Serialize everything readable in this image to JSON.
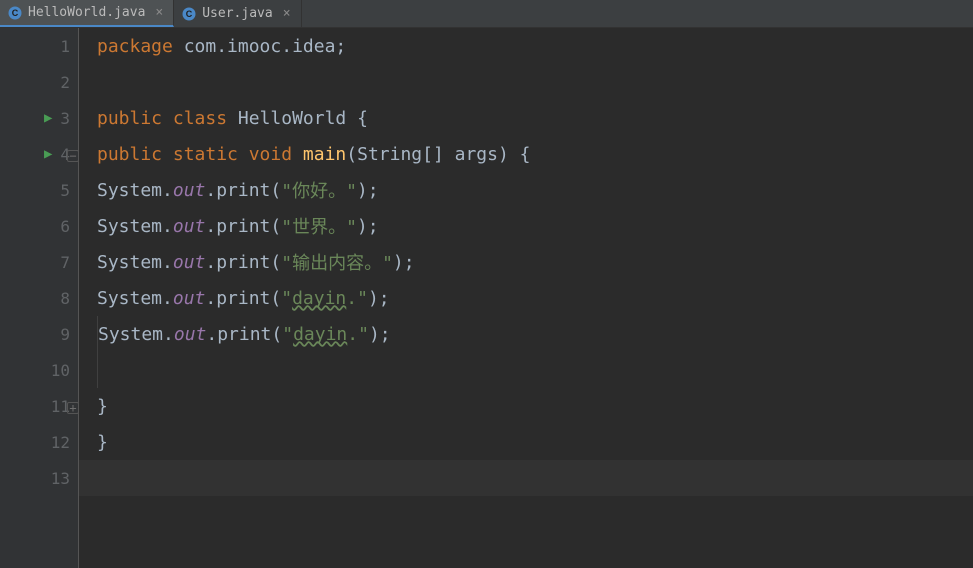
{
  "tabs": [
    {
      "label": "HelloWorld.java",
      "active": true
    },
    {
      "label": "User.java",
      "active": false
    }
  ],
  "lines": [
    "1",
    "2",
    "3",
    "4",
    "5",
    "6",
    "7",
    "8",
    "9",
    "10",
    "11",
    "12",
    "13"
  ],
  "code": {
    "l1": {
      "kw1": "package ",
      "pkg": "com.imooc.idea",
      "semi": ";"
    },
    "l3": {
      "kw1": "public class ",
      "cls": "HelloWorld ",
      "brace": "{"
    },
    "l4": {
      "kw1": "public static ",
      "kw2": "void ",
      "method": "main",
      "params": "(String[] args) ",
      "brace": "{"
    },
    "l5": {
      "sys": "System.",
      "out": "out",
      "dot": ".print(",
      "str": "\"你好。\"",
      "end": ");"
    },
    "l6": {
      "sys": "System.",
      "out": "out",
      "dot": ".print(",
      "str": "\"世界。\"",
      "end": ");"
    },
    "l7": {
      "sys": "System.",
      "out": "out",
      "dot": ".print(",
      "str": "\"输出内容。\"",
      "end": ");"
    },
    "l8": {
      "sys": "System.",
      "out": "out",
      "dot": ".print(",
      "q1": "\"",
      "typo": "dayin",
      "q2": ".\"",
      "end": ");"
    },
    "l9": {
      "sys": "System.",
      "out": "out",
      "dot": ".print(",
      "q1": "\"",
      "typo": "dayin",
      "q2": ".\"",
      "end": ");"
    },
    "l11": {
      "brace": "}"
    },
    "l12": {
      "brace": "}"
    }
  }
}
